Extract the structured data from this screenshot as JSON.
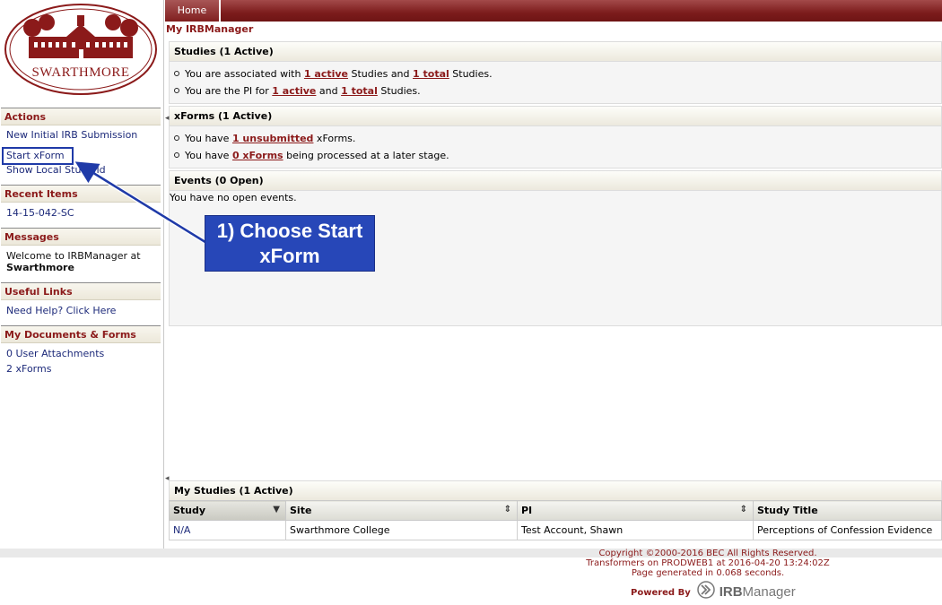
{
  "logo": {
    "text": "SWARTHMORE"
  },
  "nav": {
    "home_tab": "Home"
  },
  "page_title": "My IRBManager",
  "sidebar": {
    "actions": {
      "heading": "Actions",
      "items": [
        "New Initial IRB Submission",
        "Start xForm",
        "Show Local Study Id"
      ]
    },
    "recent": {
      "heading": "Recent Items",
      "items": [
        "14-15-042-SC"
      ]
    },
    "messages": {
      "heading": "Messages",
      "line1": "Welcome to IRBManager at",
      "line2": "Swarthmore"
    },
    "useful_links": {
      "heading": "Useful Links",
      "items": [
        "Need Help? Click Here"
      ]
    },
    "documents": {
      "heading": "My Documents & Forms",
      "items": [
        "0 User Attachments",
        "2 xForms"
      ]
    }
  },
  "studies_panel": {
    "title": "Studies (1 Active)",
    "line1": {
      "pre": "You are associated with ",
      "link1": "1 active",
      "mid": " Studies and ",
      "link2": "1 total",
      "post": " Studies."
    },
    "line2": {
      "pre": "You are the PI for ",
      "link1": "1 active",
      "mid": " and ",
      "link2": "1 total",
      "post": " Studies."
    }
  },
  "xforms_panel": {
    "title": "xForms (1 Active)",
    "line1": {
      "pre": "You have ",
      "link": "1 unsubmitted",
      "post": " xForms."
    },
    "line2": {
      "pre": "You have ",
      "link": "0 xForms",
      "post": " being processed at a later stage."
    }
  },
  "events_panel": {
    "title": "Events (0 Open)",
    "text": "You have no open events."
  },
  "my_studies": {
    "title": "My Studies (1 Active)",
    "columns": [
      "Study",
      "Site",
      "PI",
      "Study Title"
    ],
    "rows": [
      {
        "study": "N/A",
        "site": "Swarthmore College",
        "pi": "Test Account, Shawn",
        "title": "Perceptions of Confession Evidence"
      }
    ]
  },
  "footer": {
    "copyright": "Copyright ©2000-2016 BEC All Rights Reserved.",
    "server": "Transformers on PRODWEB1 at 2016-04-20 13:24:02Z",
    "generated": "Page generated in 0.068 seconds.",
    "powered_by": "Powered By",
    "brand_irb": "IRB",
    "brand_manager": "Manager"
  },
  "callout": {
    "line1": "1) Choose Start",
    "line2": "xForm"
  },
  "colors": {
    "brand": "#8b1a1a",
    "link": "#1d2a7a",
    "callout": "#2747b8"
  }
}
